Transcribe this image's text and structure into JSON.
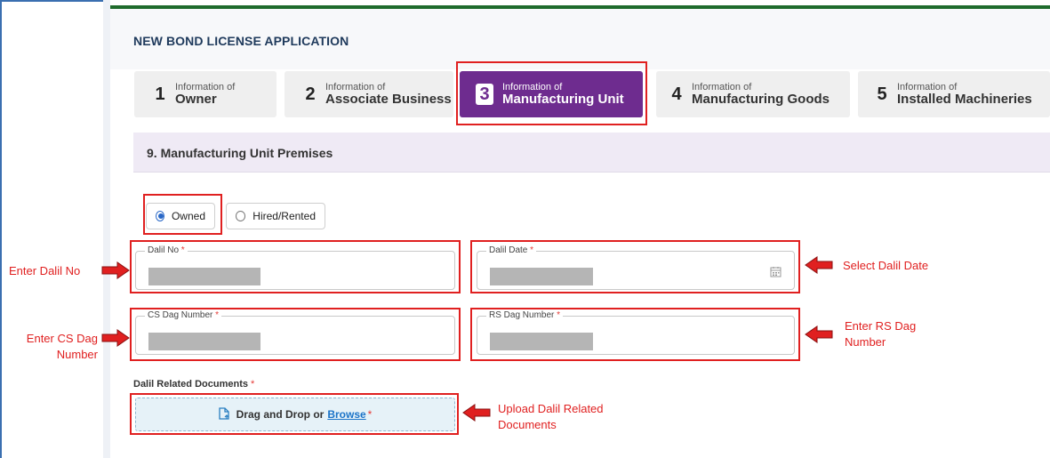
{
  "page": {
    "title": "NEW BOND LICENSE APPLICATION"
  },
  "steps": [
    {
      "num": "1",
      "small": "Information of",
      "big": "Owner",
      "active": false
    },
    {
      "num": "2",
      "small": "Information of",
      "big": "Associate Business",
      "active": false
    },
    {
      "num": "3",
      "small": "Information of",
      "big": "Manufacturing Unit",
      "active": true
    },
    {
      "num": "4",
      "small": "Information of",
      "big": "Manufacturing Goods",
      "active": false
    },
    {
      "num": "5",
      "small": "Information of",
      "big": "Installed Machineries",
      "active": false
    }
  ],
  "section": {
    "title": "9. Manufacturing Unit Premises"
  },
  "premises": {
    "options": [
      "Owned",
      "Hired/Rented"
    ],
    "selected": "Owned"
  },
  "fields": {
    "dalil_no": {
      "label": "Dalil No",
      "required": "*"
    },
    "dalil_date": {
      "label": "Dalil Date",
      "required": "*"
    },
    "cs_dag": {
      "label": "CS Dag Number",
      "required": "*"
    },
    "rs_dag": {
      "label": "RS Dag Number",
      "required": "*"
    }
  },
  "documents": {
    "label": "Dalil Related Documents",
    "required": "*",
    "drop_text": "Drag and Drop or",
    "browse_text": "Browse",
    "drop_required": "*"
  },
  "annotations": {
    "enter_dalil_no": "Enter Dalil No",
    "select_dalil_date": "Select Dalil Date",
    "enter_cs_dag_1": "Enter CS Dag",
    "enter_cs_dag_2": "Number",
    "enter_rs_dag_1": "Enter RS Dag",
    "enter_rs_dag_2": "Number",
    "upload_docs_1": "Upload Dalil Related",
    "upload_docs_2": "Documents"
  },
  "colors": {
    "accent_purple": "#6e2c8f",
    "highlight_red": "#e02020",
    "radio_blue": "#2867c7",
    "header_green": "#1f6b2c"
  },
  "icons": {
    "calendar": "calendar-icon",
    "upload": "file-upload-icon",
    "arrow": "red-arrow-icon"
  }
}
